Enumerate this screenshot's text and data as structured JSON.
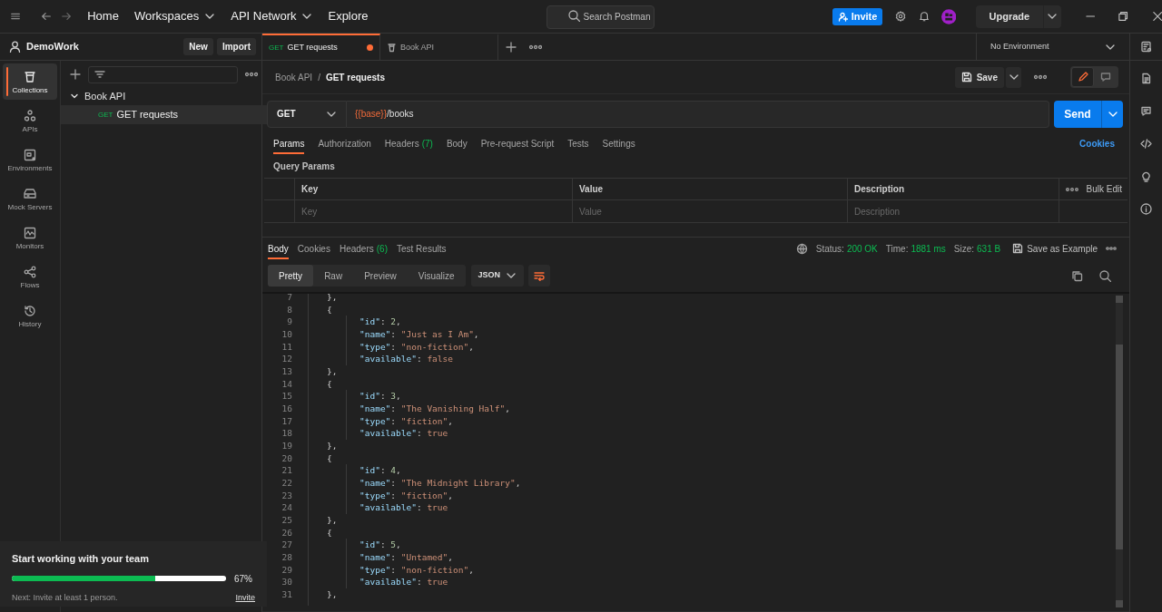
{
  "top_bar": {
    "nav": [
      {
        "label": "Home",
        "dropdown": false
      },
      {
        "label": "Workspaces",
        "dropdown": true
      },
      {
        "label": "API Network",
        "dropdown": true
      },
      {
        "label": "Explore",
        "dropdown": false
      }
    ],
    "search": {
      "placeholder": "Search Postman"
    },
    "invite_button": "Invite",
    "upgrade_button": "Upgrade"
  },
  "workspace": {
    "name": "DemoWork",
    "buttons": [
      "New",
      "Import"
    ]
  },
  "nav_rail": [
    {
      "label": "Collections",
      "selected": true
    },
    {
      "label": "APIs",
      "selected": false
    },
    {
      "label": "Environments",
      "selected": false
    },
    {
      "label": "Mock Servers",
      "selected": false
    },
    {
      "label": "Monitors",
      "selected": false
    },
    {
      "label": "Flows",
      "selected": false
    },
    {
      "label": "History",
      "selected": false
    }
  ],
  "collections_tree": [
    {
      "label": "Book API",
      "expanded": true,
      "children": [
        {
          "method": "GET",
          "label": "GET requests",
          "selected": true
        }
      ]
    }
  ],
  "onboarding": {
    "title": "Start working with your team",
    "level": 0.67,
    "reading": "67%",
    "hint": "Next: Invite at least 1 person.",
    "link": "Invite"
  },
  "tabs": [
    {
      "kind": "request",
      "method": "GET",
      "label": "GET requests",
      "selected": true,
      "unsaved": true
    },
    {
      "kind": "collection",
      "label": "Book API",
      "selected": false,
      "unsaved": false
    }
  ],
  "environment": "No Environment",
  "breadcrumb": [
    "Book API",
    "GET requests"
  ],
  "breadcrumb_separator": "/",
  "mode_toggle": [
    {
      "kind": "edit",
      "selected": true
    },
    {
      "kind": "comments",
      "selected": false
    }
  ],
  "save_button": "Save",
  "request": {
    "method": "GET",
    "url_variable": "{{base}}",
    "url_path": "/books",
    "send_button": "Send"
  },
  "request_tabs": [
    {
      "label": "Params",
      "selected": true
    },
    {
      "label": "Authorization",
      "selected": false
    },
    {
      "label": "Headers",
      "count": "(7)",
      "selected": false
    },
    {
      "label": "Body",
      "selected": false
    },
    {
      "label": "Pre-request Script",
      "selected": false
    },
    {
      "label": "Tests",
      "selected": false
    },
    {
      "label": "Settings",
      "selected": false
    }
  ],
  "cookies_link": "Cookies",
  "query_params": {
    "title": "Query Params",
    "columns": [
      "Key",
      "Value",
      "Description"
    ],
    "bulk_edit": "Bulk Edit",
    "placeholders": [
      "Key",
      "Value",
      "Description"
    ]
  },
  "response_tabs": [
    {
      "label": "Body",
      "selected": true
    },
    {
      "label": "Cookies",
      "selected": false
    },
    {
      "label": "Headers",
      "count": "(6)",
      "selected": false
    },
    {
      "label": "Test Results",
      "selected": false
    }
  ],
  "response_meta": [
    {
      "label": "Status:",
      "value": "200 OK"
    },
    {
      "label": "Time:",
      "value": "1881 ms"
    },
    {
      "label": "Size:",
      "value": "631 B"
    }
  ],
  "save_as_example": "Save as Example",
  "view_modes": [
    {
      "label": "Pretty",
      "selected": true
    },
    {
      "label": "Raw",
      "selected": false
    },
    {
      "label": "Preview",
      "selected": false
    },
    {
      "label": "Visualize",
      "selected": false
    }
  ],
  "format": "JSON",
  "code_lines": [
    {
      "number": "7",
      "kind": "brace",
      "tokens": [
        {
          "kind": "punct",
          "text": "},"
        }
      ]
    },
    {
      "number": "8",
      "kind": "brace",
      "tokens": [
        {
          "kind": "punct",
          "text": "{"
        }
      ]
    },
    {
      "number": "9",
      "kind": "member",
      "tokens": [
        {
          "kind": "key",
          "text": "\"id\""
        },
        {
          "kind": "punct",
          "text": ": "
        },
        {
          "kind": "number",
          "text": "2"
        },
        {
          "kind": "punct",
          "text": ","
        }
      ]
    },
    {
      "number": "10",
      "kind": "member",
      "tokens": [
        {
          "kind": "key",
          "text": "\"name\""
        },
        {
          "kind": "punct",
          "text": ": "
        },
        {
          "kind": "string",
          "text": "\"Just as I Am\""
        },
        {
          "kind": "punct",
          "text": ","
        }
      ]
    },
    {
      "number": "11",
      "kind": "member",
      "tokens": [
        {
          "kind": "key",
          "text": "\"type\""
        },
        {
          "kind": "punct",
          "text": ": "
        },
        {
          "kind": "string",
          "text": "\"non-fiction\""
        },
        {
          "kind": "punct",
          "text": ","
        }
      ]
    },
    {
      "number": "12",
      "kind": "member",
      "tokens": [
        {
          "kind": "key",
          "text": "\"available\""
        },
        {
          "kind": "punct",
          "text": ": "
        },
        {
          "kind": "bool",
          "text": "false"
        }
      ]
    },
    {
      "number": "13",
      "kind": "brace",
      "tokens": [
        {
          "kind": "punct",
          "text": "},"
        }
      ]
    },
    {
      "number": "14",
      "kind": "brace",
      "tokens": [
        {
          "kind": "punct",
          "text": "{"
        }
      ]
    },
    {
      "number": "15",
      "kind": "member",
      "tokens": [
        {
          "kind": "key",
          "text": "\"id\""
        },
        {
          "kind": "punct",
          "text": ": "
        },
        {
          "kind": "number",
          "text": "3"
        },
        {
          "kind": "punct",
          "text": ","
        }
      ]
    },
    {
      "number": "16",
      "kind": "member",
      "tokens": [
        {
          "kind": "key",
          "text": "\"name\""
        },
        {
          "kind": "punct",
          "text": ": "
        },
        {
          "kind": "string",
          "text": "\"The Vanishing Half\""
        },
        {
          "kind": "punct",
          "text": ","
        }
      ]
    },
    {
      "number": "17",
      "kind": "member",
      "tokens": [
        {
          "kind": "key",
          "text": "\"type\""
        },
        {
          "kind": "punct",
          "text": ": "
        },
        {
          "kind": "string",
          "text": "\"fiction\""
        },
        {
          "kind": "punct",
          "text": ","
        }
      ]
    },
    {
      "number": "18",
      "kind": "member",
      "tokens": [
        {
          "kind": "key",
          "text": "\"available\""
        },
        {
          "kind": "punct",
          "text": ": "
        },
        {
          "kind": "bool",
          "text": "true"
        }
      ]
    },
    {
      "number": "19",
      "kind": "brace",
      "tokens": [
        {
          "kind": "punct",
          "text": "},"
        }
      ]
    },
    {
      "number": "20",
      "kind": "brace",
      "tokens": [
        {
          "kind": "punct",
          "text": "{"
        }
      ]
    },
    {
      "number": "21",
      "kind": "member",
      "tokens": [
        {
          "kind": "key",
          "text": "\"id\""
        },
        {
          "kind": "punct",
          "text": ": "
        },
        {
          "kind": "number",
          "text": "4"
        },
        {
          "kind": "punct",
          "text": ","
        }
      ]
    },
    {
      "number": "22",
      "kind": "member",
      "tokens": [
        {
          "kind": "key",
          "text": "\"name\""
        },
        {
          "kind": "punct",
          "text": ": "
        },
        {
          "kind": "string",
          "text": "\"The Midnight Library\""
        },
        {
          "kind": "punct",
          "text": ","
        }
      ]
    },
    {
      "number": "23",
      "kind": "member",
      "tokens": [
        {
          "kind": "key",
          "text": "\"type\""
        },
        {
          "kind": "punct",
          "text": ": "
        },
        {
          "kind": "string",
          "text": "\"fiction\""
        },
        {
          "kind": "punct",
          "text": ","
        }
      ]
    },
    {
      "number": "24",
      "kind": "member",
      "tokens": [
        {
          "kind": "key",
          "text": "\"available\""
        },
        {
          "kind": "punct",
          "text": ": "
        },
        {
          "kind": "bool",
          "text": "true"
        }
      ]
    },
    {
      "number": "25",
      "kind": "brace",
      "tokens": [
        {
          "kind": "punct",
          "text": "},"
        }
      ]
    },
    {
      "number": "26",
      "kind": "brace",
      "tokens": [
        {
          "kind": "punct",
          "text": "{"
        }
      ]
    },
    {
      "number": "27",
      "kind": "member",
      "tokens": [
        {
          "kind": "key",
          "text": "\"id\""
        },
        {
          "kind": "punct",
          "text": ": "
        },
        {
          "kind": "number",
          "text": "5"
        },
        {
          "kind": "punct",
          "text": ","
        }
      ]
    },
    {
      "number": "28",
      "kind": "member",
      "tokens": [
        {
          "kind": "key",
          "text": "\"name\""
        },
        {
          "kind": "punct",
          "text": ": "
        },
        {
          "kind": "string",
          "text": "\"Untamed\""
        },
        {
          "kind": "punct",
          "text": ","
        }
      ]
    },
    {
      "number": "29",
      "kind": "member",
      "tokens": [
        {
          "kind": "key",
          "text": "\"type\""
        },
        {
          "kind": "punct",
          "text": ": "
        },
        {
          "kind": "string",
          "text": "\"non-fiction\""
        },
        {
          "kind": "punct",
          "text": ","
        }
      ]
    },
    {
      "number": "30",
      "kind": "member",
      "tokens": [
        {
          "kind": "key",
          "text": "\"available\""
        },
        {
          "kind": "punct",
          "text": ": "
        },
        {
          "kind": "bool",
          "text": "true"
        }
      ]
    },
    {
      "number": "31",
      "kind": "brace",
      "tokens": [
        {
          "kind": "punct",
          "text": "},"
        }
      ]
    }
  ]
}
